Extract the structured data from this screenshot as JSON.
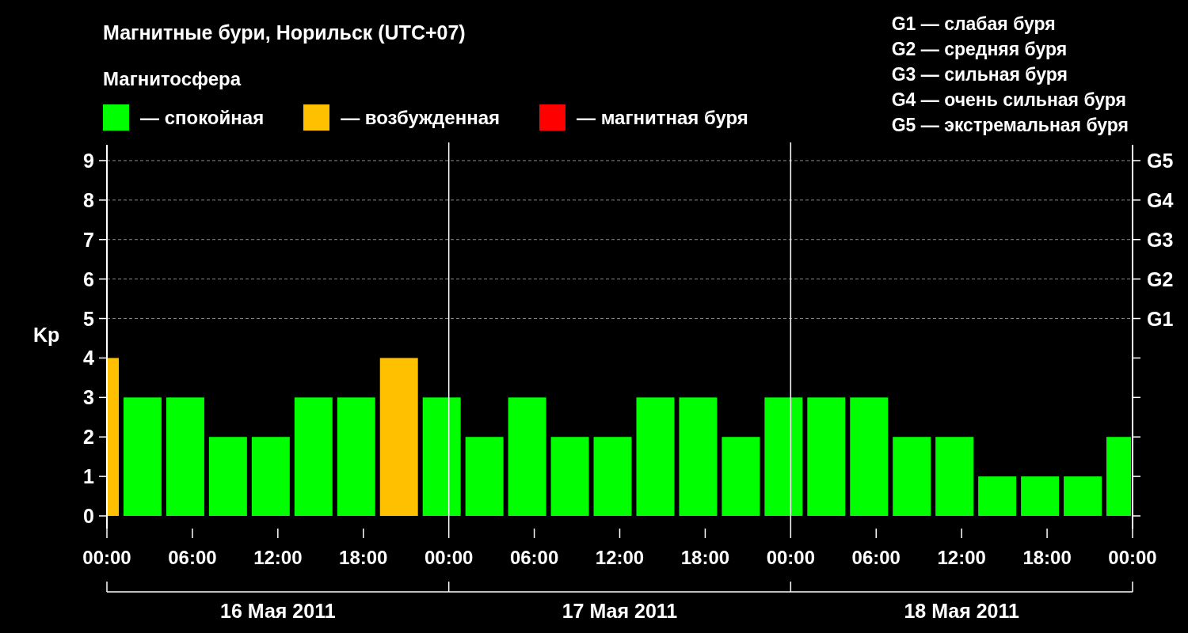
{
  "title": "Магнитные бури, Норильск (UTC+07)",
  "legend_title": "Магнитосфера",
  "scale": [
    "G1 — слабая буря",
    "G2 — средняя буря",
    "G3 — сильная буря",
    "G4 — очень сильная буря",
    "G5 — экстремальная буря"
  ],
  "chart": {
    "days": [
      "16 Мая 2011",
      "17 Мая 2011",
      "18 Мая 2011"
    ],
    "right_axis": [
      "G5",
      "G4",
      "G3",
      "G2",
      "G1"
    ],
    "chart_data": {
      "type": "bar",
      "ylabel": "Kp",
      "ylim": [
        0,
        9.4
      ],
      "grid": true,
      "xlim": [
        "2011-05-16T00:00",
        "2011-05-19T00:00"
      ],
      "x": [
        "2011-05-16T00:30",
        "2011-05-16T02:30",
        "2011-05-16T05:30",
        "2011-05-16T08:30",
        "2011-05-16T11:30",
        "2011-05-16T14:30",
        "2011-05-16T17:30",
        "2011-05-16T20:30",
        "2011-05-16T23:30",
        "2011-05-17T02:30",
        "2011-05-17T05:30",
        "2011-05-17T08:30",
        "2011-05-17T11:30",
        "2011-05-17T14:30",
        "2011-05-17T17:30",
        "2011-05-17T20:30",
        "2011-05-17T23:30",
        "2011-05-18T02:30",
        "2011-05-18T05:30",
        "2011-05-18T08:30",
        "2011-05-18T11:30",
        "2011-05-18T14:30",
        "2011-05-18T17:30",
        "2011-05-18T20:30",
        "2011-05-18T23:00"
      ],
      "series": [
        {
          "name": "— спокойная",
          "color": "#00ff00",
          "values": [
            null,
            3,
            3,
            2,
            2,
            3,
            3,
            null,
            3,
            2,
            3,
            2,
            2,
            3,
            3,
            2,
            3,
            3,
            3,
            2,
            2,
            1,
            1,
            1,
            2
          ]
        },
        {
          "name": "— возбужденная",
          "color": "#ffc000",
          "values": [
            4,
            null,
            null,
            null,
            null,
            null,
            null,
            4,
            null,
            null,
            null,
            null,
            null,
            null,
            null,
            null,
            null,
            null,
            null,
            null,
            null,
            null,
            null,
            null,
            null
          ]
        },
        {
          "name": "— магнитная буря",
          "color": "#ff0000",
          "values": [
            null,
            null,
            null,
            null,
            null,
            null,
            null,
            null,
            null,
            null,
            null,
            null,
            null,
            null,
            null,
            null,
            null,
            null,
            null,
            null,
            null,
            null,
            null,
            null,
            null
          ]
        }
      ],
      "yticks": [
        0,
        1,
        2,
        3,
        4,
        5,
        6,
        7,
        8,
        9
      ],
      "xticks": [
        {
          "value": "2011-05-16T00:00",
          "label": "00:00"
        },
        {
          "value": "2011-05-16T06:00",
          "label": "06:00"
        },
        {
          "value": "2011-05-16T12:00",
          "label": "12:00"
        },
        {
          "value": "2011-05-16T18:00",
          "label": "18:00"
        },
        {
          "value": "2011-05-17T00:00",
          "label": "00:00"
        },
        {
          "value": "2011-05-17T06:00",
          "label": "06:00"
        },
        {
          "value": "2011-05-17T12:00",
          "label": "12:00"
        },
        {
          "value": "2011-05-17T18:00",
          "label": "18:00"
        },
        {
          "value": "2011-05-18T00:00",
          "label": "00:00"
        },
        {
          "value": "2011-05-18T06:00",
          "label": "06:00"
        },
        {
          "value": "2011-05-18T12:00",
          "label": "12:00"
        },
        {
          "value": "2011-05-18T18:00",
          "label": "18:00"
        },
        {
          "value": "2011-05-19T00:00",
          "label": "00:00"
        }
      ]
    }
  }
}
